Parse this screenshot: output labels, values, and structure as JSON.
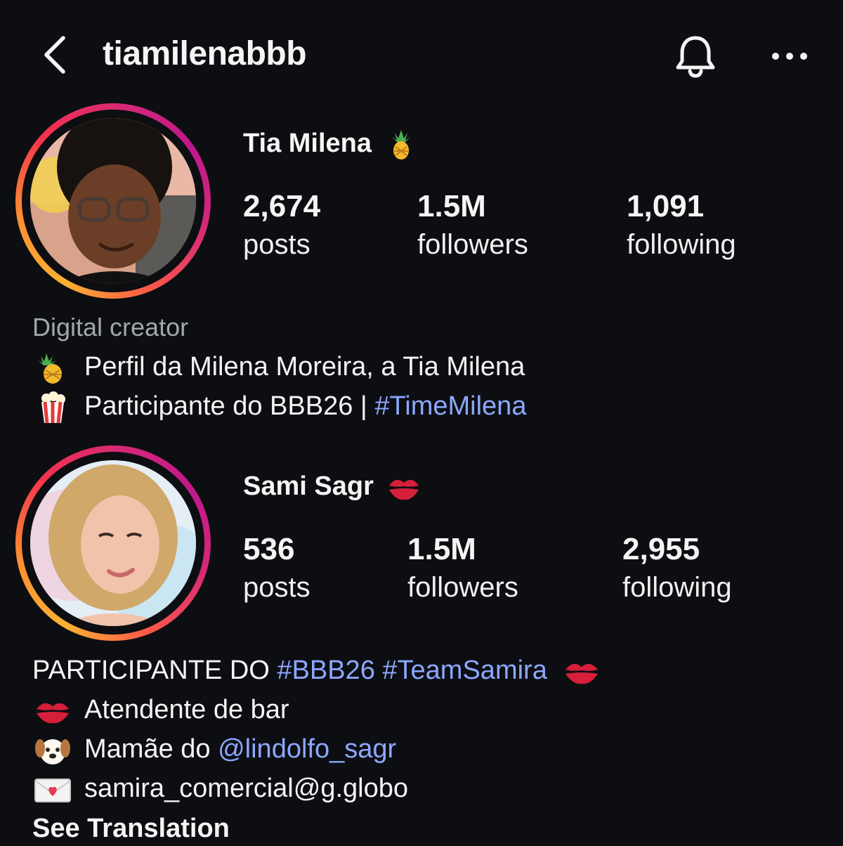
{
  "header": {
    "username": "tiamilenabbb"
  },
  "profiles": [
    {
      "display_name": "Tia Milena",
      "name_emoji": "pineapple-icon",
      "stats": {
        "posts_count": "2,674",
        "posts_label": "posts",
        "followers_count": "1.5M",
        "followers_label": "followers",
        "following_count": "1,091",
        "following_label": "following"
      },
      "category": "Digital creator",
      "bio": {
        "line1_emoji": "pineapple-icon",
        "line1_text": "Perfil da Milena Moreira, a Tia Milena",
        "line2_emoji": "popcorn-icon",
        "line2_text": "Participante do BBB26 | ",
        "line2_hashtag": "#TimeMilena"
      }
    },
    {
      "display_name": "Sami Sagr",
      "name_emoji": "kiss-mark-icon",
      "stats": {
        "posts_count": "536",
        "posts_label": "posts",
        "followers_count": "1.5M",
        "followers_label": "followers",
        "following_count": "2,955",
        "following_label": "following"
      },
      "bio": {
        "line1_text": "PARTICIPANTE DO ",
        "line1_hashtag1": "#BBB26",
        "line1_hashtag2": "#TeamSamira",
        "line2_text": "Atendente de bar",
        "line3_text": "Mamãe do ",
        "line3_mention": "@lindolfo_sagr",
        "line4_text": "samira_comercial@g.globo"
      },
      "see_translation": "See Translation"
    }
  ],
  "colors": {
    "background": "#0d0e12",
    "text": "#f5f5f5",
    "muted": "#a3a6ad",
    "link": "#8ca8ff"
  }
}
